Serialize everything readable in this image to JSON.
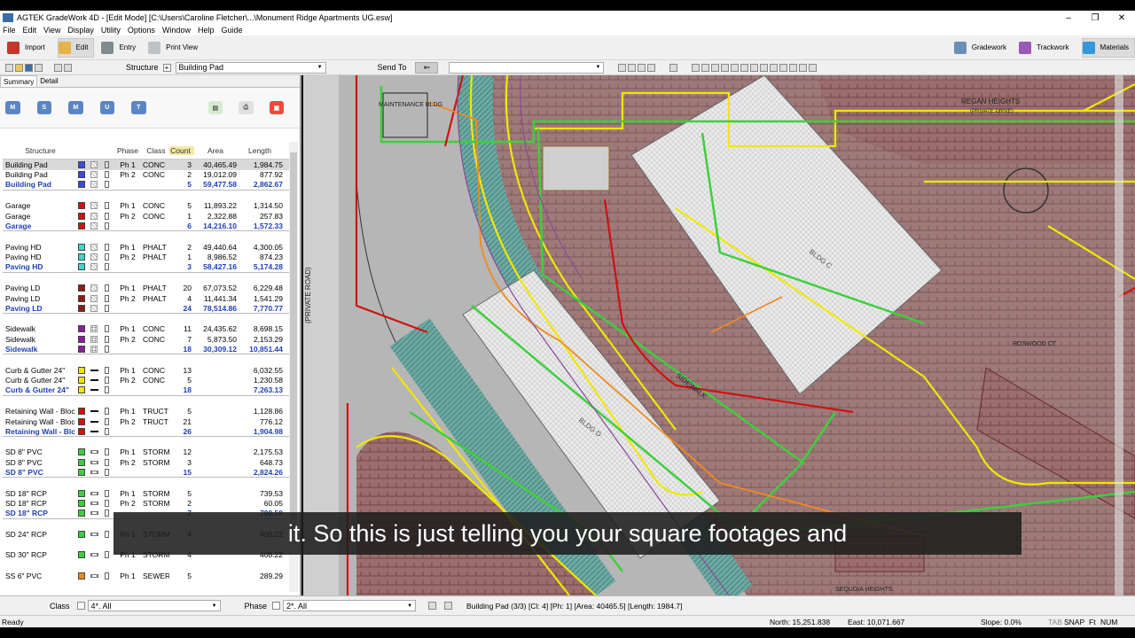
{
  "window": {
    "title": "AGTEK GradeWork 4D - [Edit Mode]  [C:\\Users\\Caroline Fletcher\\...\\Monument Ridge Apartments UG.esw]"
  },
  "menu": [
    "File",
    "Edit",
    "View",
    "Display",
    "Utility",
    "Options",
    "Window",
    "Help",
    "Guide"
  ],
  "toolbar": {
    "import": "Import",
    "edit": "Edit",
    "entry": "Entry",
    "print_view": "Print View",
    "gradework": "Gradework",
    "trackwork": "Trackwork",
    "materials": "Materials"
  },
  "toolbar2": {
    "structure_label": "Structure",
    "structure_value": "Building Pad",
    "send_to": "Send To"
  },
  "tabs": {
    "summary": "Summary",
    "detail": "Detail"
  },
  "summary_icons": [
    "M",
    "S",
    "M",
    "U",
    "T"
  ],
  "grid": {
    "headers": {
      "structure": "Structure",
      "phase": "Phase",
      "class": "Class",
      "count": "Count",
      "area": "Area",
      "length": "Length"
    },
    "rows": [
      {
        "name": "Building Pad",
        "color": "#3c4bd8",
        "pat": "hatch",
        "phase": "Ph 1",
        "cls": "CONC",
        "count": "3",
        "area": "40,465.49",
        "length": "1,984.75"
      },
      {
        "name": "Building Pad",
        "color": "#3c4bd8",
        "pat": "hatch",
        "phase": "Ph 2",
        "cls": "CONC",
        "count": "2",
        "area": "19,012.09",
        "length": "877.92"
      },
      {
        "name": "Building Pad",
        "color": "#3c4bd8",
        "pat": "hatch",
        "phase": "",
        "cls": "",
        "count": "5",
        "area": "59,477.58",
        "length": "2,862.67",
        "total": true
      },
      {
        "spacer": true
      },
      {
        "name": "Garage",
        "color": "#d01010",
        "pat": "hatch",
        "phase": "Ph 1",
        "cls": "CONC",
        "count": "5",
        "area": "11,893.22",
        "length": "1,314.50"
      },
      {
        "name": "Garage",
        "color": "#d01010",
        "pat": "hatch",
        "phase": "Ph 2",
        "cls": "CONC",
        "count": "1",
        "area": "2,322.88",
        "length": "257.83"
      },
      {
        "name": "Garage",
        "color": "#d01010",
        "pat": "hatch",
        "phase": "",
        "cls": "",
        "count": "6",
        "area": "14,216.10",
        "length": "1,572.33",
        "total": true
      },
      {
        "spacer": true
      },
      {
        "name": "Paving HD",
        "color": "#3fd6c8",
        "pat": "hatch",
        "phase": "Ph 1",
        "cls": "PHALT",
        "count": "2",
        "area": "49,440.64",
        "length": "4,300.05"
      },
      {
        "name": "Paving HD",
        "color": "#3fd6c8",
        "pat": "hatch",
        "phase": "Ph 2",
        "cls": "PHALT",
        "count": "1",
        "area": "8,986.52",
        "length": "874.23"
      },
      {
        "name": "Paving HD",
        "color": "#3fd6c8",
        "pat": "hatch",
        "phase": "",
        "cls": "",
        "count": "3",
        "area": "58,427.16",
        "length": "5,174.28",
        "total": true
      },
      {
        "spacer": true
      },
      {
        "name": "Paving LD",
        "color": "#8a1c1c",
        "pat": "hatch",
        "phase": "Ph 1",
        "cls": "PHALT",
        "count": "20",
        "area": "67,073.52",
        "length": "6,229.48"
      },
      {
        "name": "Paving LD",
        "color": "#8a1c1c",
        "pat": "hatch",
        "phase": "Ph 2",
        "cls": "PHALT",
        "count": "4",
        "area": "11,441.34",
        "length": "1,541.29"
      },
      {
        "name": "Paving LD",
        "color": "#8a1c1c",
        "pat": "hatch",
        "phase": "",
        "cls": "",
        "count": "24",
        "area": "78,514.86",
        "length": "7,770.77",
        "total": true
      },
      {
        "spacer": true
      },
      {
        "name": "Sidewalk",
        "color": "#8a1e9c",
        "pat": "dots",
        "phase": "Ph 1",
        "cls": "CONC",
        "count": "11",
        "area": "24,435.62",
        "length": "8,698.15"
      },
      {
        "name": "Sidewalk",
        "color": "#8a1e9c",
        "pat": "dots",
        "phase": "Ph 2",
        "cls": "CONC",
        "count": "7",
        "area": "5,873.50",
        "length": "2,153.29"
      },
      {
        "name": "Sidewalk",
        "color": "#8a1e9c",
        "pat": "dots",
        "phase": "",
        "cls": "",
        "count": "18",
        "area": "30,309.12",
        "length": "10,851.44",
        "total": true
      },
      {
        "spacer": true
      },
      {
        "name": "Curb & Gutter 24\"",
        "color": "#f0e800",
        "pat": "line",
        "phase": "Ph 1",
        "cls": "CONC",
        "count": "13",
        "area": "",
        "length": "6,032.55"
      },
      {
        "name": "Curb & Gutter 24\"",
        "color": "#f0e800",
        "pat": "line",
        "phase": "Ph 2",
        "cls": "CONC",
        "count": "5",
        "area": "",
        "length": "1,230.58"
      },
      {
        "name": "Curb & Gutter 24\"",
        "color": "#f0e800",
        "pat": "line",
        "phase": "",
        "cls": "",
        "count": "18",
        "area": "",
        "length": "7,263.13",
        "total": true
      },
      {
        "spacer": true
      },
      {
        "name": "Retaining Wall - Bloc",
        "color": "#d01010",
        "pat": "line",
        "phase": "Ph 1",
        "cls": "TRUCT",
        "count": "5",
        "area": "",
        "length": "1,128.86"
      },
      {
        "name": "Retaining Wall - Bloc",
        "color": "#d01010",
        "pat": "line",
        "phase": "Ph 2",
        "cls": "TRUCT",
        "count": "21",
        "area": "",
        "length": "776.12"
      },
      {
        "name": "Retaining Wall - Blc",
        "color": "#d01010",
        "pat": "line",
        "phase": "",
        "cls": "",
        "count": "26",
        "area": "",
        "length": "1,904.98",
        "total": true
      },
      {
        "spacer": true
      },
      {
        "name": "SD 8\" PVC",
        "color": "#3ecf3e",
        "pat": "pipe",
        "phase": "Ph 1",
        "cls": "STORM",
        "count": "12",
        "area": "",
        "length": "2,175.53"
      },
      {
        "name": "SD 8\" PVC",
        "color": "#3ecf3e",
        "pat": "pipe",
        "phase": "Ph 2",
        "cls": "STORM",
        "count": "3",
        "area": "",
        "length": "648.73"
      },
      {
        "name": "SD 8\" PVC",
        "color": "#3ecf3e",
        "pat": "pipe",
        "phase": "",
        "cls": "",
        "count": "15",
        "area": "",
        "length": "2,824.26",
        "total": true
      },
      {
        "spacer": true
      },
      {
        "name": "SD 18\" RCP",
        "color": "#3ecf3e",
        "pat": "pipe",
        "phase": "Ph 1",
        "cls": "STORM",
        "count": "5",
        "area": "",
        "length": "739.53"
      },
      {
        "name": "SD 18\" RCP",
        "color": "#3ecf3e",
        "pat": "pipe",
        "phase": "Ph 2",
        "cls": "STORM",
        "count": "2",
        "area": "",
        "length": "60.05"
      },
      {
        "name": "SD 18\" RCP",
        "color": "#3ecf3e",
        "pat": "pipe",
        "phase": "",
        "cls": "",
        "count": "7",
        "area": "",
        "length": "799.58",
        "total": true
      },
      {
        "spacer": true
      },
      {
        "name": "SD 24\" RCP",
        "color": "#3ecf3e",
        "pat": "pipe",
        "phase": "Ph 1",
        "cls": "STORM",
        "count": "4",
        "area": "",
        "length": "408.22"
      },
      {
        "spacer": true
      },
      {
        "name": "SD 30\" RCP",
        "color": "#3ecf3e",
        "pat": "pipe",
        "phase": "Ph 1",
        "cls": "STORM",
        "count": "4",
        "area": "",
        "length": "408.22"
      },
      {
        "spacer": true
      },
      {
        "name": "SS 6\" PVC",
        "color": "#f08a20",
        "pat": "pipe",
        "phase": "Ph 1",
        "cls": "SEWER",
        "count": "5",
        "area": "",
        "length": "289.29"
      }
    ]
  },
  "map_labels": {
    "maintenance": "MAINTENANCE BLDG",
    "private_road": "(PRIVATE ROAD)",
    "regan": "REGAN HEIGHTS",
    "private_drive": "(PRIVATE DRIVE)",
    "sidewalk": "SIDEWALK",
    "bldg_c": "BLDG C",
    "bldg_d": "BLDG D",
    "right_street": "ROSWOOD CT",
    "bottom_street": "SEQUOIA HEIGHTS"
  },
  "subtitle": "it. So this is just telling you your square footages and",
  "bottom": {
    "class_label": "Class",
    "class_value": "4*. All",
    "phase_label": "Phase",
    "phase_value": "2*. All",
    "selection": "Building Pad (3/3) [Cl: 4] [Ph: 1] [Area: 40465.5] [Length: 1984.7]"
  },
  "status": {
    "ready": "Ready",
    "north": "North: 15,251.838",
    "east": "East: 10,071.667",
    "slope": "Slope: 0.0%",
    "tab": "TAB",
    "snap": "SNAP",
    "ft": "Ft",
    "num": "NUM"
  },
  "colors": {
    "curb": "#f0e800",
    "storm": "#3ecf3e",
    "paving_ld": "#8a4a4a",
    "sewer": "#f08a20",
    "retaining": "#d01010",
    "sidewalk_fill": "#5fa8a0"
  }
}
